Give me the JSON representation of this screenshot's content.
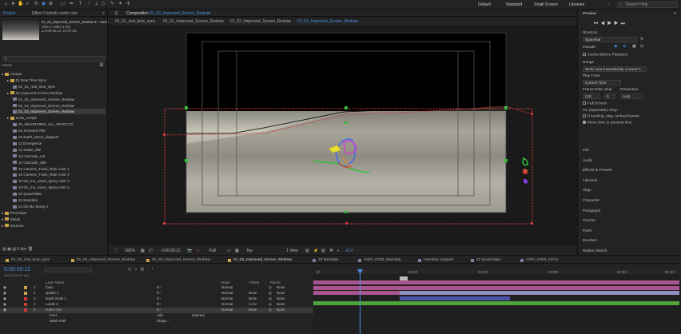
{
  "toolbar": {
    "workspaces": [
      "Default",
      "Standard",
      "Small Screen",
      "Libraries"
    ],
    "search_placeholder": "Search Help"
  },
  "project": {
    "tabs": [
      "Project",
      "Effect Controls surfer roto"
    ],
    "selected_name": "01_03_Improved_Screen_Redraw ▾ , used 4 times",
    "selected_info1": "1920 x 1080 (1.00)",
    "selected_info2": "Δ 0:00:05:13, 24.00 fps",
    "search_placeholder": "",
    "items": [
      {
        "label": "Comps",
        "type": "folder",
        "indent": 0
      },
      {
        "label": "01 Real Time Sync",
        "type": "folder",
        "indent": 1
      },
      {
        "label": "01_01_real_time_sync",
        "type": "comp",
        "indent": 2
      },
      {
        "label": "02 Improved Screen Redraw",
        "type": "folder",
        "indent": 1
      },
      {
        "label": "01_01_Improved_Screen_Redraw",
        "type": "comp",
        "indent": 2
      },
      {
        "label": "01_02_Improved_Screen_Redraw",
        "type": "comp",
        "indent": 2
      },
      {
        "label": "01_03_Improved_Screen_Redraw",
        "type": "comp",
        "indent": 2,
        "selected": true
      },
      {
        "label": "extra_comps",
        "type": "folder",
        "indent": 1
      },
      {
        "label": "00_WAVEFORM_ALL_EFFECTS",
        "type": "comp",
        "indent": 2
      },
      {
        "label": "01 Screwed Title",
        "type": "comp",
        "indent": 2
      },
      {
        "label": "04 Earth_Moon_diagram",
        "type": "comp",
        "indent": 2
      },
      {
        "label": "11 Emergence",
        "type": "comp",
        "indent": 2
      },
      {
        "label": "12 snake_title",
        "type": "comp",
        "indent": 2
      },
      {
        "label": "13 Cascade_cut",
        "type": "comp",
        "indent": 2
      },
      {
        "label": "14 Cascade_360",
        "type": "comp",
        "indent": 2
      },
      {
        "label": "15 Camera_Track_Ride color 1",
        "type": "comp",
        "indent": 2
      },
      {
        "label": "16 Camera_Track_Ride color 2",
        "type": "comp",
        "indent": 2
      },
      {
        "label": "18 Do_mo_carve_spray color 1",
        "type": "comp",
        "indent": 2
      },
      {
        "label": "19 Do_mo_carve_spray color 2",
        "type": "comp",
        "indent": 2
      },
      {
        "label": "22 Quad Mala",
        "type": "comp",
        "indent": 2
      },
      {
        "label": "23 Mandala",
        "type": "comp",
        "indent": 2
      },
      {
        "label": "24 Do Mo Spray A",
        "type": "comp",
        "indent": 2
      },
      {
        "label": "Precomps",
        "type": "folder",
        "indent": 0
      },
      {
        "label": "Solids",
        "type": "folder",
        "indent": 0
      },
      {
        "label": "Sources",
        "type": "folder",
        "indent": 0
      }
    ],
    "bpc": "8 bpc"
  },
  "composition": {
    "panel_title": "Composition",
    "panel_comp": "01_03_Improved_Screen_Redraw",
    "breadcrumbs": [
      "01_01_real_time_sync",
      "01_01_Improved_Screen_Redraw",
      "01_02_Improved_Screen_Redraw",
      "01_03_Improved_Screen_Redraw"
    ],
    "zoom": "100%",
    "timecode": "0:00:00:12",
    "resolution": "Full",
    "view": "Top",
    "views": "1 View",
    "exposure": "+0.0"
  },
  "preview": {
    "title": "Preview",
    "shortcut_label": "Shortcut",
    "shortcut_value": "Spacebar",
    "include_label": "Include:",
    "cache_label": "Cache Before Playback",
    "range_label": "Range",
    "range_value": "Work Area Extended By Current T...",
    "play_from_label": "Play From",
    "play_from_value": "Current Time",
    "frame_rate_label": "Frame Rate",
    "skip_label": "Skip",
    "resolution_label": "Resolution",
    "frame_rate_value": "(24)",
    "skip_value": "0",
    "resolution_value": "Auto",
    "full_screen_label": "Full Screen",
    "on_stop_label": "On (Spacebar) Stop:",
    "if_caching_label": "If caching, play cached frames",
    "move_time_label": "Move time to preview time",
    "sections": [
      "Info",
      "Audio",
      "Effects & Presets",
      "Libraries",
      "Align",
      "Character",
      "Paragraph",
      "Tracker",
      "Paint",
      "Brushes",
      "Motion Sketch"
    ]
  },
  "timeline": {
    "tabs": [
      "01_01_real_time_sync",
      "01_01_Improved_Screen_Redraw",
      "01_02_Improved_Screen_Redraw",
      "01_03_Improved_Screen_Redraw",
      "23 Mandala",
      "A007_C053_Mandala",
      "mandala cropped",
      "22 Quad Mala",
      "A007_C053_mirror"
    ],
    "timecode": "0:00:00:12",
    "frames": "00012 (24.00 fps)",
    "columns": {
      "source": "Layer Name",
      "mode": "Mode",
      "trkmat": "TrkMat",
      "parent": "Parent"
    },
    "ruler": [
      "0f",
      "01:00f",
      "02:00f",
      "03:00f",
      "04:00f",
      "05:00f"
    ],
    "layers": [
      {
        "num": "1",
        "name": "foam",
        "mode": "Normal",
        "trk": "",
        "parent": "None",
        "color": "#c9a24a"
      },
      {
        "num": "2",
        "name": "splash 2",
        "mode": "Normal",
        "trk": "None",
        "parent": "None",
        "color": "#c9a24a"
      },
      {
        "num": "3",
        "name": "leash mask 2",
        "mode": "Normal",
        "trk": "None",
        "parent": "None",
        "color": "#d23a3a"
      },
      {
        "num": "4",
        "name": "Leash 2",
        "mode": "Normal",
        "trk": "A.Inv",
        "parent": "None",
        "color": "#d23a3a"
      },
      {
        "num": "5",
        "name": "surfer roto",
        "mode": "Normal",
        "trk": "None",
        "parent": "None",
        "color": "#d23a3a",
        "selected": true
      }
    ],
    "sub_rows": [
      {
        "label": "Feet",
        "value": "Add",
        "extra": "Inverted"
      },
      {
        "label": "Mask Path",
        "value": "Shape...",
        "extra": ""
      }
    ]
  }
}
